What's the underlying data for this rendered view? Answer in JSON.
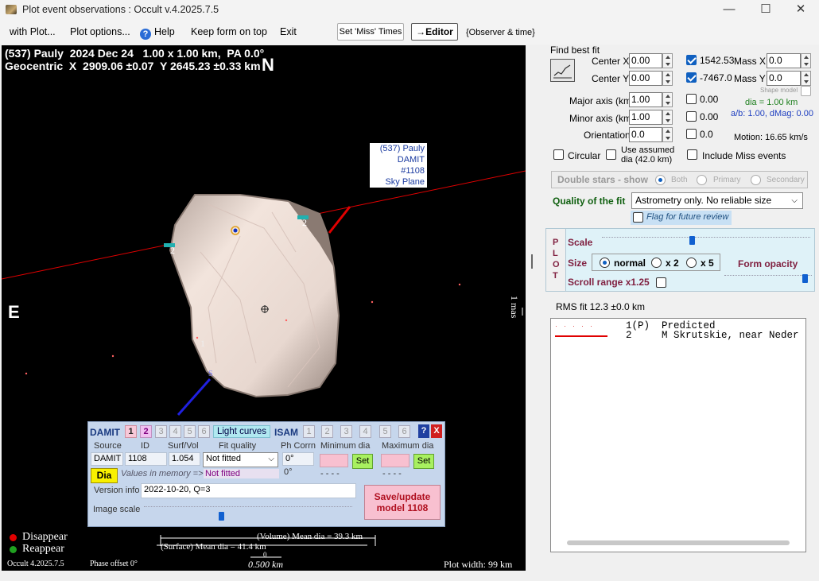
{
  "window": {
    "title": "Plot event observations : Occult v.4.2025.7.5",
    "minimize": "—",
    "maximize": "☐",
    "close": "✕"
  },
  "menu": {
    "items": [
      "with Plot...",
      "Plot options...",
      "Help",
      "Keep form on top",
      "Exit"
    ],
    "set_miss_times": "Set 'Miss' Times",
    "editor": "→Editor",
    "observer_time": "{Observer & time}"
  },
  "plot": {
    "header_line1": "(537) Pauly  2024 Dec 24   1.00 x 1.00 km,  PA 0.0°",
    "header_line2": "Geocentric  X  2909.06 ±0.07  Y 2645.23 ±0.33 km",
    "north": "N",
    "east": "E",
    "label_box": [
      "(537) Pauly",
      "DAMIT #1108",
      "Sky Plane"
    ],
    "chord_label_a": "2",
    "chord_label_b": "2",
    "chord_label_1": "1",
    "pole_label": "S",
    "scale_mas": "1 mas",
    "legend_disappear": "Disappear",
    "legend_reappear": "Reappear",
    "version": "Occult 4.2025.7.5",
    "phase_offset": "Phase offset 0°",
    "mean_volume": "(Volume) Mean dia = 39.3 km",
    "mean_surface": "(Surface) Mean dia = 41.4 km",
    "scale_bar": "0.500 km",
    "plot_width": "Plot width: 99 km",
    "scale_zero": "0",
    "colors": {
      "disappear": "#e00000",
      "reappear": "#20a020",
      "chord": "#e00000",
      "pole": "#2020e0"
    }
  },
  "damit": {
    "title": "DAMIT",
    "nums": [
      "1",
      "2",
      "3",
      "4",
      "5",
      "6"
    ],
    "light_curves": "Light curves",
    "isam": "ISAM",
    "isam_nums": [
      "1",
      "2",
      "3",
      "4",
      "5",
      "6"
    ],
    "help": "?",
    "close": "X",
    "col_source": "Source",
    "col_id": "ID",
    "col_surfvol": "Surf/Vol",
    "col_fit": "Fit quality",
    "col_phcorr": "Ph Corrn",
    "col_min": "Minimum dia",
    "col_max": "Maximum dia",
    "source": "DAMIT",
    "id": "1108",
    "surfvol": "1.054",
    "fit_quality": "Not fitted",
    "fit_quality2": "Not fitted",
    "phcorr": "0°",
    "phcorr2": "0°",
    "dash1": "- - - -",
    "dash2": "- - - -",
    "set": "Set",
    "dia": "Dia",
    "values_in_memory": "Values in memory =>",
    "version_info_label": "Version info",
    "version_info": "2022-10-20, Q=3",
    "image_scale": "Image scale",
    "save_update": "Save/update model  1108"
  },
  "side": {
    "find_best_fit": "Find best fit",
    "center_x_label": "Center X",
    "center_x": "0.00",
    "center_y_label": "Center Y",
    "center_y": "0.00",
    "cx_value": "1542.53",
    "cy_value": "-7467.0",
    "mass_x_label": "Mass X",
    "mass_x": "0.0",
    "mass_y_label": "Mass Y",
    "mass_y": "0.0",
    "shape_model": "Shape model",
    "major_label": "Major axis (km)",
    "major": "1.00",
    "major_val": "0.00",
    "minor_label": "Minor axis (km)",
    "minor": "1.00",
    "minor_val": "0.00",
    "orient_label": "Orientation",
    "orient": "0.0",
    "orient_val": "0.0",
    "dia_text": "dia = 1.00 km",
    "ab_text": "a/b: 1.00, dMag: 0.00",
    "motion": "Motion: 16.65 km/s",
    "circular": "Circular",
    "use_assumed": "Use assumed dia (42.0 km)",
    "include_miss": "Include Miss events",
    "double_stars": "Double stars - show",
    "ds_both": "Both",
    "ds_primary": "Primary",
    "ds_secondary": "Secondary",
    "quality_label": "Quality of the fit",
    "quality_value": "Astrometry only. No reliable size",
    "flag_review": "Flag for future review",
    "plot_vertical": [
      "P",
      "L",
      "O",
      "T"
    ],
    "scale_label": "Scale",
    "size_label": "Size",
    "size_normal": "normal",
    "size_x2": "x 2",
    "size_x5": "x 5",
    "form_opacity": "Form opacity",
    "scroll_range": "Scroll range x1.25",
    "rms_fit": "RMS fit 12.3 ±0.0 km",
    "rms_rows": [
      {
        "num": "1(P)",
        "name": "Predicted"
      },
      {
        "num": "2",
        "name": "M Skrutskie, near Neder"
      }
    ]
  }
}
